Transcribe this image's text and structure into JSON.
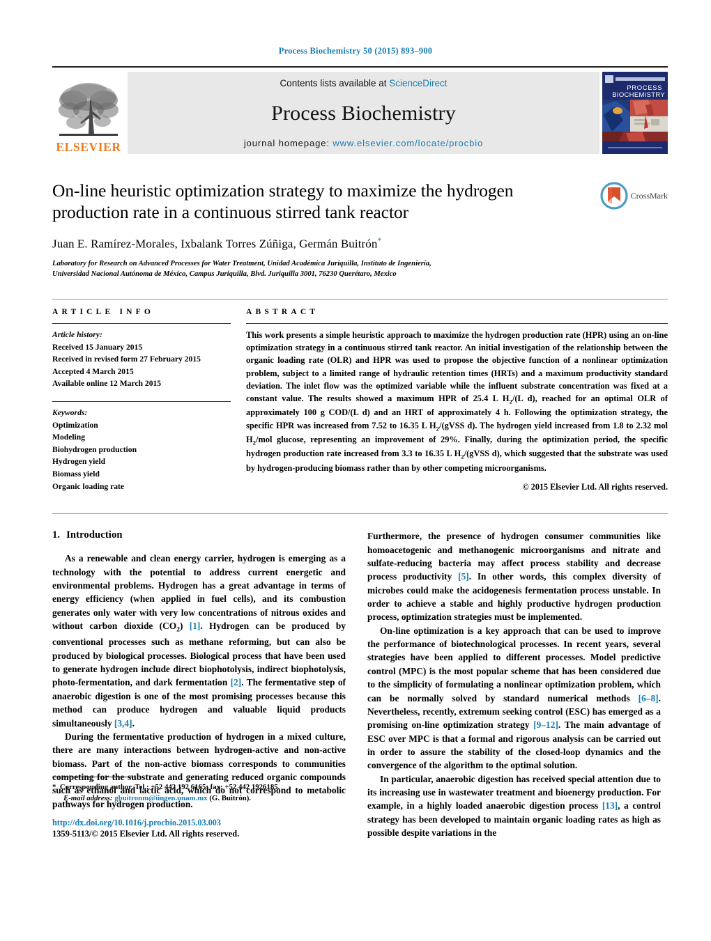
{
  "running_head": "Process Biochemistry 50 (2015) 893–900",
  "masthead": {
    "contents_prefix": "Contents lists available at ",
    "contents_link": "ScienceDirect",
    "journal_name": "Process Biochemistry",
    "homepage_prefix": "journal homepage: ",
    "homepage_url": "www.elsevier.com/locate/procbio",
    "publisher": "ELSEVIER",
    "cover_title_line1": "PROCESS",
    "cover_title_line2": "BIOCHEMISTRY",
    "logo_icon": "elsevier-tree-logo"
  },
  "article": {
    "title": "On-line heuristic optimization strategy to maximize the hydrogen production rate in a continuous stirred tank reactor",
    "authors": "Juan E. Ramírez-Morales, Ixbalank Torres Zúñiga, Germán Buitrón",
    "author_star": "*",
    "affiliation_line1": "Laboratory for Research on Advanced Processes for Water Treatment, Unidad Académica Juriquilla, Instituto de Ingeniería,",
    "affiliation_line2": "Universidad Nacional Autónoma de México, Campus Juriquilla, Blvd. Juriquilla 3001, 76230 Querétaro, Mexico",
    "crossmark_label": "CrossMark"
  },
  "article_info": {
    "heading": "ARTICLE INFO",
    "history_label": "Article history:",
    "history": [
      "Received 15 January 2015",
      "Received in revised form 27 February 2015",
      "Accepted 4 March 2015",
      "Available online 12 March 2015"
    ],
    "keywords_label": "Keywords:",
    "keywords": [
      "Optimization",
      "Modeling",
      "Biohydrogen production",
      "Hydrogen yield",
      "Biomass yield",
      "Organic loading rate"
    ]
  },
  "abstract": {
    "heading": "ABSTRACT",
    "p1_a": "This work presents a simple heuristic approach to maximize the hydrogen production rate (HPR) using an on-line optimization strategy in a continuous stirred tank reactor. An initial investigation of the relationship between the organic loading rate (OLR) and HPR was used to propose the objective function of a nonlinear optimization problem, subject to a limited range of hydraulic retention times (HRTs) and a maximum productivity standard deviation. The inlet flow was the optimized variable while the influent substrate concentration was fixed at a constant value. The results showed a maximum HPR of 25.4 L H",
    "p1_b": "/(L d), reached for an optimal OLR of approximately 100 g COD/(L d) and an HRT of approximately 4 h. Following the optimization strategy, the specific HPR was increased from 7.52 to 16.35 L H",
    "p1_c": "/(gVSS d). The hydrogen yield increased from 1.8 to 2.32 mol H",
    "p1_d": "/mol glucose, representing an improvement of 29%. Finally, during the optimization period, the specific hydrogen production rate increased from 3.3 to 16.35 L H",
    "p1_e": "/(gVSS d), which suggested that the substrate was used by hydrogen-producing biomass rather than by other competing microorganisms.",
    "subscript": "2",
    "copyright": "© 2015 Elsevier Ltd. All rights reserved."
  },
  "body": {
    "section_number": "1.",
    "section_title": "Introduction",
    "left": {
      "p1_a": "As a renewable and clean energy carrier, hydrogen is emerging as a technology with the potential to address current energetic and environmental problems. Hydrogen has a great advantage in terms of energy efficiency (when applied in fuel cells), and its combustion generates only water with very low concentrations of nitrous oxides and without carbon dioxide (CO",
      "p1_sub": "2",
      "p1_b": ") ",
      "p1_ref1": "[1]",
      "p1_c": ". Hydrogen can be produced by conventional processes such as methane reforming, but can also be produced by biological processes. Biological process that have been used to generate hydrogen include direct biophotolysis, indirect biophotolysis, photo-fermentation, and dark fermentation ",
      "p1_ref2": "[2]",
      "p1_d": ". The fermentative step of anaerobic digestion is one of the most promising processes because this method can produce hydrogen and valuable liquid products simultaneously ",
      "p1_ref3": "[3,4]",
      "p1_e": ".",
      "p2": "During the fermentative production of hydrogen in a mixed culture, there are many interactions between hydrogen-active and non-active biomass. Part of the non-active biomass corresponds to communities competing for the substrate and generating reduced organic compounds such as ethanol and lactic acid, which do not correspond to metabolic pathways for hydrogen production."
    },
    "right": {
      "p1_a": "Furthermore, the presence of hydrogen consumer communities like homoacetogenic and methanogenic microorganisms and nitrate and sulfate-reducing bacteria may affect process stability and decrease process productivity ",
      "p1_ref1": "[5]",
      "p1_b": ". In other words, this complex diversity of microbes could make the acidogenesis fermentation process unstable. In order to achieve a stable and highly productive hydrogen production process, optimization strategies must be implemented.",
      "p2_a": "On-line optimization is a key approach that can be used to improve the performance of biotechnological processes. In recent years, several strategies have been applied to different processes. Model predictive control (MPC) is the most popular scheme that has been considered due to the simplicity of formulating a nonlinear optimization problem, which can be normally solved by standard numerical methods ",
      "p2_ref1": "[6–8]",
      "p2_b": ". Nevertheless, recently, extremum seeking control (ESC) has emerged as a promising on-line optimization strategy ",
      "p2_ref2": "[9–12]",
      "p2_c": ". The main advantage of ESC over MPC is that a formal and rigorous analysis can be carried out in order to assure the stability of the closed-loop dynamics and the convergence of the algorithm to the optimal solution.",
      "p3_a": "In particular, anaerobic digestion has received special attention due to its increasing use in wastewater treatment and bioenergy production. For example, in a highly loaded anaerobic digestion process ",
      "p3_ref1": "[13]",
      "p3_b": ", a control strategy has been developed to maintain organic loading rates as high as possible despite variations in the"
    }
  },
  "footnote": {
    "star": "*",
    "corresponding": "Corresponding author. Tel.: +52 442 192 6165; fax: +52 442 1926185.",
    "email_label": "E-mail address:",
    "email": "gbuitronm@iingen.unam.mx",
    "email_suffix": "(G. Buitrón)."
  },
  "footer": {
    "doi": "http://dx.doi.org/10.1016/j.procbio.2015.03.003",
    "issn": "1359-5113/© 2015 Elsevier Ltd. All rights reserved."
  },
  "colors": {
    "link_blue": "#1a7bb0",
    "elsevier_orange": "#ef7d22",
    "band_grey": "#e8e8e8"
  }
}
